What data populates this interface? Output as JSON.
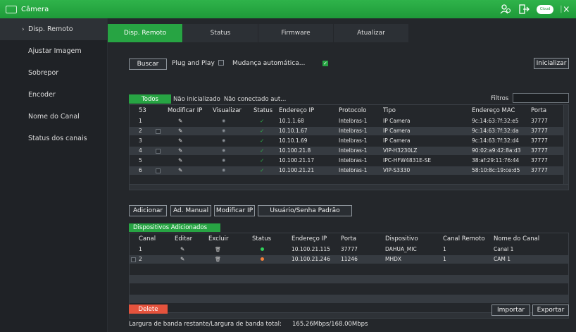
{
  "window": {
    "title": "Câmera"
  },
  "sidebar": {
    "items": [
      {
        "label": "Disp. Remoto"
      },
      {
        "label": "Ajustar Imagem"
      },
      {
        "label": "Sobrepor"
      },
      {
        "label": "Encoder"
      },
      {
        "label": "Nome do Canal"
      },
      {
        "label": "Status dos canais"
      }
    ]
  },
  "tabs": [
    {
      "label": "Disp. Remoto"
    },
    {
      "label": "Status"
    },
    {
      "label": "Firmware"
    },
    {
      "label": "Atualizar"
    }
  ],
  "toolbar": {
    "search": "Buscar",
    "plug_and_play": "Plug and Play",
    "auto_change": "Mudança automática...",
    "initialize": "Inicializar"
  },
  "filters": {
    "tabs": [
      "Todos",
      "Não inicializado",
      "Não conectado aut..."
    ],
    "label": "Filtros"
  },
  "found": {
    "headers": [
      "53",
      "Modificar IP",
      "Visualizar",
      "Status",
      "Endereço IP",
      "Protocolo",
      "Tipo",
      "Endereço MAC",
      "Porta"
    ],
    "rows": [
      {
        "n": "1",
        "ip": "10.1.1.68",
        "protocol": "Intelbras-1",
        "type": "IP Camera",
        "mac": "9c:14:63:7f:32:e5",
        "port": "37777"
      },
      {
        "n": "2",
        "ip": "10.10.1.67",
        "protocol": "Intelbras-1",
        "type": "IP Camera",
        "mac": "9c:14:63:7f:32:da",
        "port": "37777"
      },
      {
        "n": "3",
        "ip": "10.10.1.69",
        "protocol": "Intelbras-1",
        "type": "IP Camera",
        "mac": "9c:14:63:7f:32:d4",
        "port": "37777"
      },
      {
        "n": "4",
        "ip": "10.100.21.8",
        "protocol": "Intelbras-1",
        "type": "VIP-H3230LZ",
        "mac": "90:02:a9:42:8a:d3",
        "port": "37777"
      },
      {
        "n": "5",
        "ip": "10.100.21.17",
        "protocol": "Intelbras-1",
        "type": "IPC-HFW4831E-SE",
        "mac": "38:af:29:11:76:44",
        "port": "37777"
      },
      {
        "n": "6",
        "ip": "10.100.21.21",
        "protocol": "Intelbras-1",
        "type": "VIP-S3330",
        "mac": "58:10:8c:19:ce:d5",
        "port": "37777"
      }
    ]
  },
  "actions": {
    "add": "Adicionar",
    "manual_add": "Ad. Manual",
    "modify_ip": "Modificar IP",
    "default_user": "Usuário/Senha Padrão"
  },
  "added": {
    "title": "Dispositivos Adicionados",
    "headers": [
      "Canal",
      "Editar",
      "Excluir",
      "Status",
      "Endereço IP",
      "Porta",
      "Dispositivo",
      "Canal Remoto",
      "Nome do Canal"
    ],
    "rows": [
      {
        "channel": "1",
        "ip": "10.100.21.115",
        "port": "37777",
        "device": "DAHUA_MIC",
        "remote": "1",
        "name": "Canal 1",
        "status": "online"
      },
      {
        "channel": "2",
        "ip": "10.100.21.246",
        "port": "11246",
        "device": "MHDX",
        "remote": "1",
        "name": "CAM 1",
        "status": "offline"
      }
    ]
  },
  "footer": {
    "delete": "Delete",
    "bandwidth_label": "Largura de banda restante/Largura de banda total:",
    "bandwidth_value": "165.26Mbps/168.00Mbps",
    "import": "Importar",
    "export": "Exportar"
  },
  "colors": {
    "accent": "#27a443",
    "online": "#2fd05a",
    "offline": "#f5803a",
    "delete": "#e5533d"
  }
}
